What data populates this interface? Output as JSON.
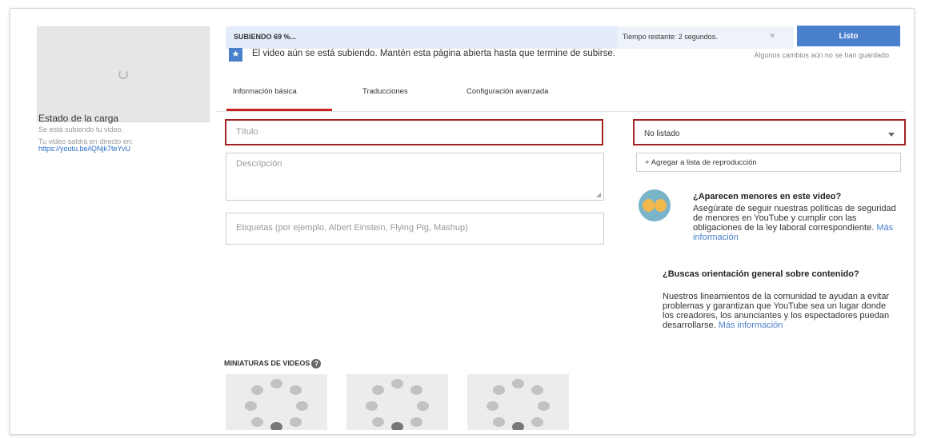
{
  "upload_status": {
    "title": "Estado de la carga",
    "line1": "Se está subiendo tu video.",
    "line2": "Tu video saldrá en directo en:",
    "link": "https://youtu.be/iQNjk7teYvU"
  },
  "progress": {
    "label": "SUBIENDO 69 %...",
    "percent": 69,
    "time_remaining": "Tiempo restante: 2 segundos.",
    "close_icon": "close-icon"
  },
  "done_button": "Listo",
  "unsaved_note": "Algunos cambios aún no se han guardado",
  "info_message": "El video aún se está subiendo. Mantén esta página abierta hasta que termine de subirse.",
  "tabs": [
    {
      "label": "Información básica",
      "active": true
    },
    {
      "label": "Traducciones",
      "active": false
    },
    {
      "label": "Configuración avanzada",
      "active": false
    }
  ],
  "form": {
    "title_placeholder": "Título",
    "description_placeholder": "Descripción",
    "tags_placeholder": "Etiquetas (por ejemplo, Albert Einstein, Flying Pig, Mashup)",
    "visibility": "No listado",
    "playlist_button": "+ Agregar a lista de reproducción"
  },
  "minors_notice": {
    "title": "¿Aparecen menores en este video?",
    "body": "Asegúrate de seguir nuestras políticas de seguridad de menores en YouTube y cumplir con las obligaciones de la ley laboral correspondiente.",
    "link": "Más información"
  },
  "guidance_notice": {
    "title": "¿Buscas orientación general sobre contenido?",
    "body": "Nuestros lineamientos de la comunidad te ayudan a evitar problemas y garantizan que YouTube sea un lugar donde los creadores, los anunciantes y los espectadores puedan desarrollarse.",
    "link": "Más información"
  },
  "thumbnails": {
    "label": "MINIATURAS DE VIDEOS",
    "help_icon": "help-icon",
    "count_shown": 3
  },
  "colors": {
    "accent_blue": "#4a7fcb",
    "active_tab_red": "#cc1f1f",
    "highlight_border": "#a32222"
  }
}
